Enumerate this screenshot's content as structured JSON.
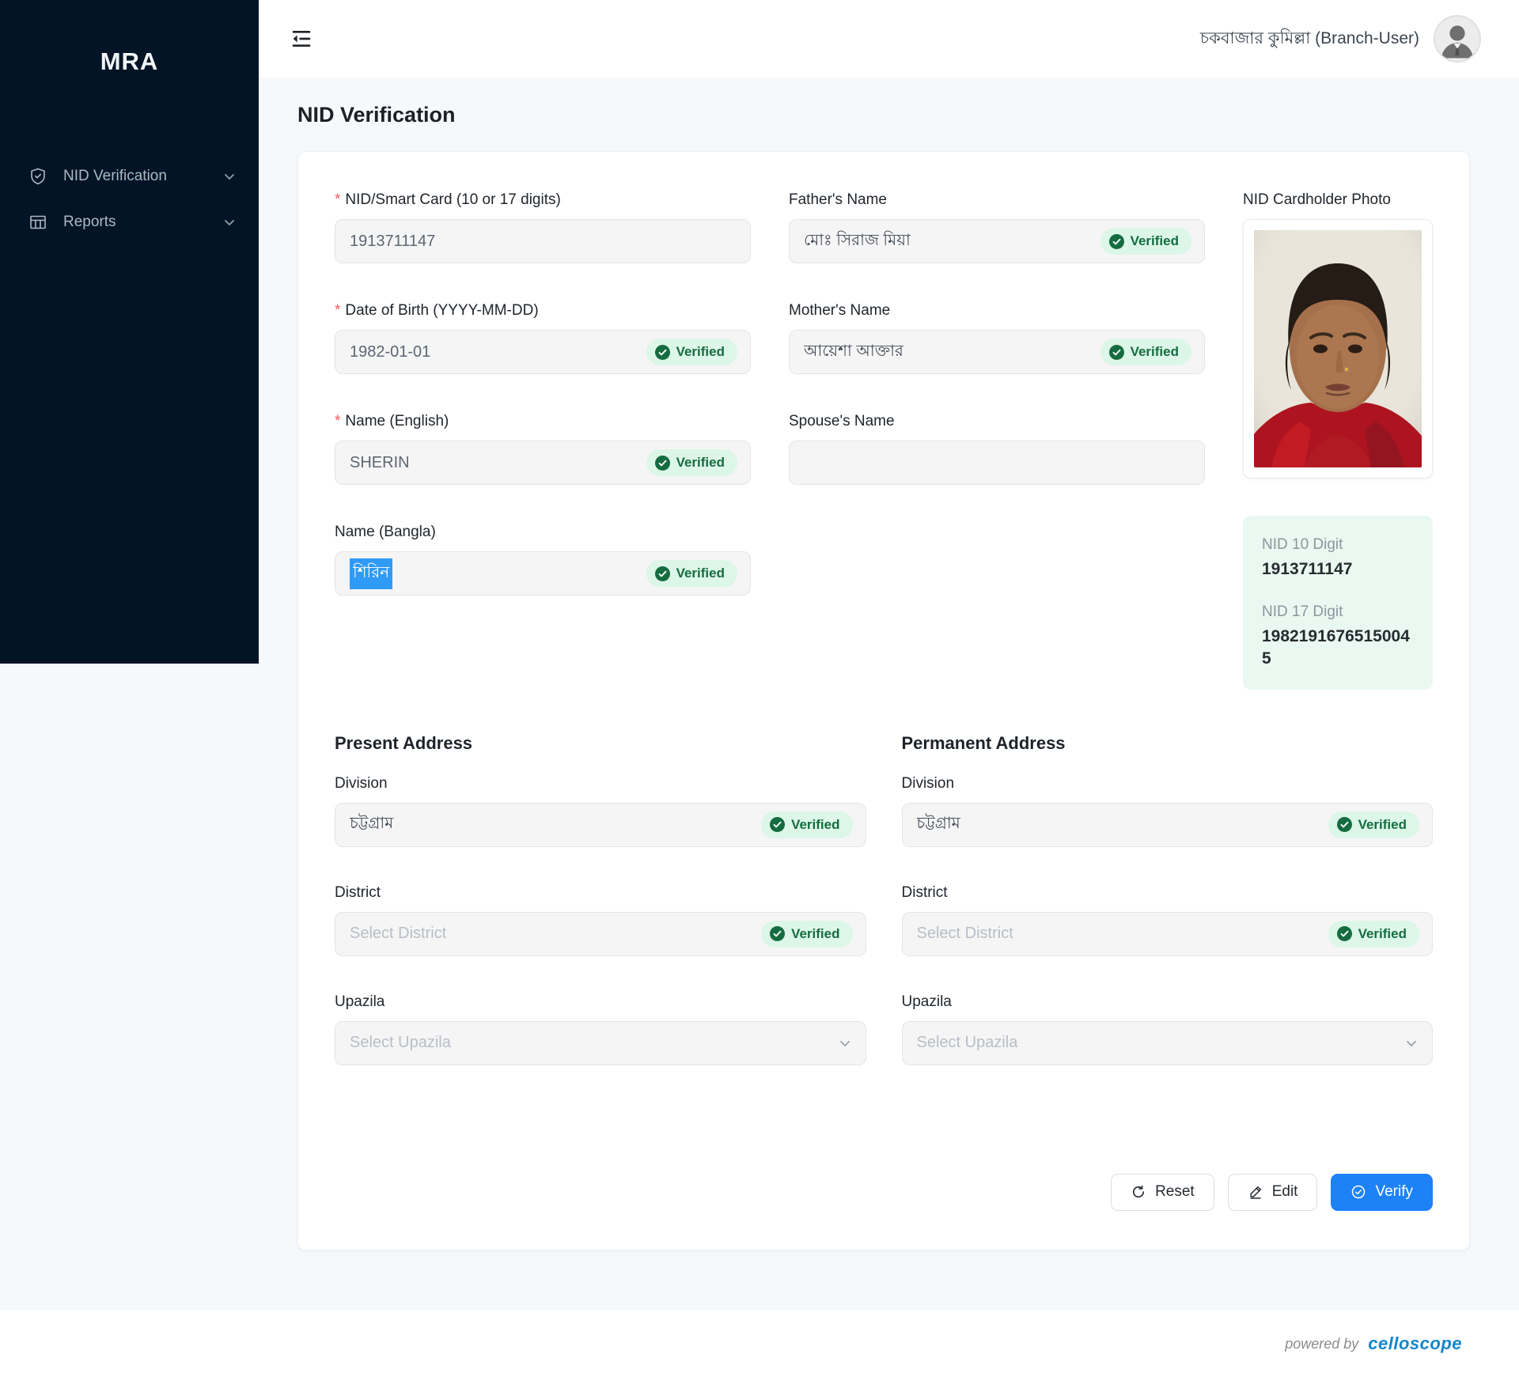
{
  "colors": {
    "sidebar_bg": "#021426",
    "accent_blue": "#1e82f7",
    "verified_green": "#156c40",
    "verified_bg": "#dcf6e7",
    "selection_blue": "#2f9bf7",
    "brand_blue": "#1386ca"
  },
  "sidebar": {
    "logo": "MRA",
    "items": [
      {
        "label": "NID Verification",
        "icon": "shield-icon"
      },
      {
        "label": "Reports",
        "icon": "table-icon"
      }
    ]
  },
  "header": {
    "user_label": "চকবাজার কুমিল্লা (Branch-User)",
    "avatar_icon": "person-icon"
  },
  "page_title": "NID Verification",
  "form": {
    "required_marker": "*",
    "verified_label": "Verified",
    "nid": {
      "label": "NID/Smart Card (10 or 17 digits)",
      "value": "1913711147"
    },
    "dob": {
      "label": "Date of Birth (YYYY-MM-DD)",
      "value": "1982-01-01"
    },
    "name_english": {
      "label": "Name (English)",
      "value": "SHERIN"
    },
    "name_bangla": {
      "label": "Name (Bangla)",
      "value": "শিরিন"
    },
    "father_name": {
      "label": "Father's Name",
      "value": "মোঃ সিরাজ মিয়া"
    },
    "mother_name": {
      "label": "Mother's Name",
      "value": "আয়েশা আক্তার"
    },
    "spouse_name": {
      "label": "Spouse's Name",
      "value": ""
    },
    "photo_label": "NID Cardholder Photo",
    "nid_summary": {
      "nid10_label": "NID 10 Digit",
      "nid10_value": "1913711147",
      "nid17_label": "NID 17 Digit",
      "nid17_value": "19821916765150045"
    },
    "present_address": {
      "title": "Present Address",
      "division_label": "Division",
      "division_value": "চট্টগ্রাম",
      "district_label": "District",
      "district_placeholder": "Select District",
      "upazila_label": "Upazila",
      "upazila_placeholder": "Select Upazila"
    },
    "permanent_address": {
      "title": "Permanent Address",
      "division_label": "Division",
      "division_value": "চট্টগ্রাম",
      "district_label": "District",
      "district_placeholder": "Select District",
      "upazila_label": "Upazila",
      "upazila_placeholder": "Select Upazila"
    },
    "buttons": {
      "reset": "Reset",
      "edit": "Edit",
      "verify": "Verify"
    }
  },
  "footer": {
    "powered_by": "powered by",
    "brand": "celloscope"
  }
}
